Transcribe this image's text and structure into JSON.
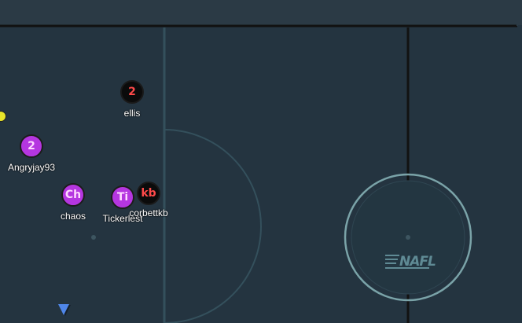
{
  "rink": {
    "logo_text": "NAFL",
    "colors": {
      "ice": "#243440",
      "wall": "#111111",
      "circle": "#7aa3a8",
      "team_purple": "#b536e0",
      "team_black": "#0b0b0b",
      "puck": "#e8e52a",
      "marker": "#4f86e8"
    }
  },
  "players": [
    {
      "name": "ellis",
      "token": "2",
      "team": "black"
    },
    {
      "name": "Angryjay93",
      "token": "2",
      "team": "purple"
    },
    {
      "name": "chaos",
      "token": "Ch",
      "team": "purple"
    },
    {
      "name": "Tickerlest",
      "token": "Ti",
      "team": "purple"
    },
    {
      "name": "corbettkb",
      "token": "kb",
      "team": "black"
    }
  ],
  "puck": {
    "icon": "puck-icon"
  },
  "marker": {
    "icon": "down-triangle-icon"
  }
}
